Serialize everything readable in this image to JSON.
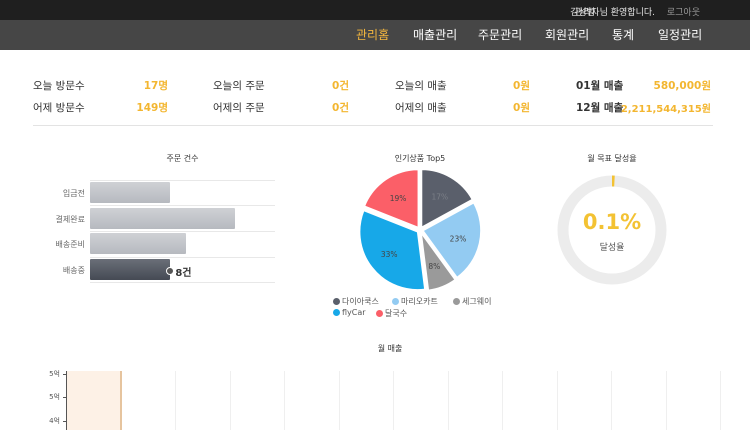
{
  "topbar": {
    "user_name": "김성범",
    "welcome": "관리자님 환영합니다.",
    "logout": "로그아웃"
  },
  "nav": {
    "items": [
      "관리홈",
      "매출관리",
      "주문관리",
      "회원관리",
      "통계",
      "일정관리"
    ],
    "active": "관리홈"
  },
  "stats": {
    "today_visitors_label": "오늘 방문수",
    "today_visitors": "17명",
    "yesterday_visitors_label": "어제 방문수",
    "yesterday_visitors": "149명",
    "today_orders_label": "오늘의 주문",
    "today_orders": "0건",
    "yesterday_orders_label": "어제의 주문",
    "yesterday_orders": "0건",
    "today_sales_label": "오늘의 매출",
    "today_sales": "0원",
    "yesterday_sales_label": "어제의 매출",
    "yesterday_sales": "0원",
    "month1_sales_label": "01월 매출",
    "month1_sales": "580,000원",
    "month12_sales_label": "12월 매출",
    "month12_sales": "2,211,544,315원"
  },
  "colors": {
    "accent": "#f3b630",
    "nav_bg": "#464646",
    "topbar_bg": "#1f1f1f"
  },
  "chart_data": [
    {
      "type": "bar",
      "title": "주문 건수",
      "orientation": "horizontal",
      "categories": [
        "입금전",
        "결제완료",
        "배송준비",
        "배송중"
      ],
      "values": [
        5,
        9,
        6,
        5
      ],
      "highlighted_label": "8건"
    },
    {
      "type": "pie",
      "title": "인기상품 Top5",
      "labels": [
        "다이아쿡스",
        "마리오카트",
        "세그웨이",
        "flyCar",
        "달국수"
      ],
      "values": [
        17,
        23,
        8,
        33,
        19
      ],
      "slice_labels": [
        "17%",
        "23%",
        "8%",
        "33%",
        "19%"
      ],
      "colors": [
        "#5a5f6b",
        "#93cbf2",
        "#9a9a9a",
        "#17a8e8",
        "#fb5f68"
      ]
    },
    {
      "type": "pie",
      "title": "월 목표 달성율",
      "values": [
        0.1
      ],
      "value_label": "0.1%",
      "sub_label": "달성율"
    },
    {
      "type": "bar",
      "title": "월 매출",
      "y_tick_labels": [
        "5억",
        "5억",
        "4억"
      ]
    }
  ]
}
